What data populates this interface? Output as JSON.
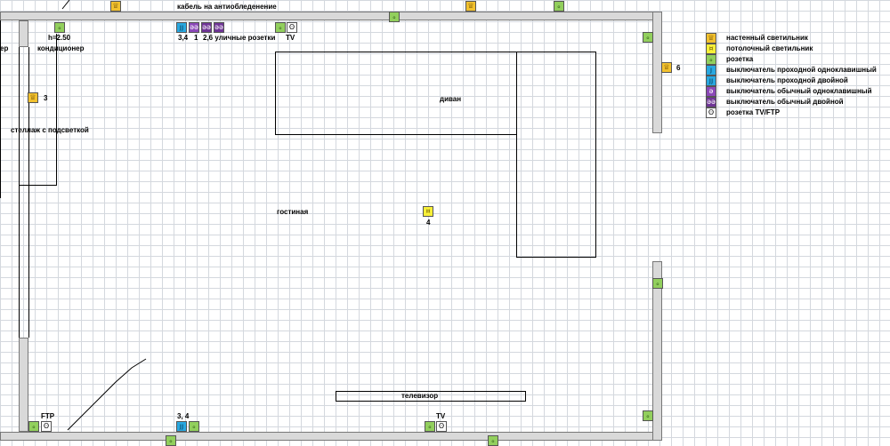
{
  "labels": {
    "cable": "кабель на антиобледенение",
    "height": "h=2.50",
    "ac": "кондиционер",
    "left_cut": "ер",
    "shelf": "стеллаж с подсветкой",
    "room": "гостиная",
    "sofa": "диван",
    "tv_stand": "телевизор",
    "switch_top_a": "3,4",
    "switch_top_b": "1",
    "switch_top_c": "2,6 уличные розетки",
    "tv_top": "TV",
    "lamp_left_num": "3",
    "ceil_num": "4",
    "lamp_right_num": "6",
    "ftp": "FTP",
    "switch_bottom": "3, 4",
    "tv_bottom": "TV"
  },
  "icons": {
    "wall_lamp": "♕",
    "ceil_lamp": "¤",
    "socket": "ₒ",
    "switch_pass_single": "ȷ",
    "switch_pass_double": "ȷȷ",
    "switch_single": "ә",
    "switch_double": "әә",
    "tv_socket": "ʘ"
  },
  "legend": [
    {
      "type": "wall-lamp",
      "icon": "♕",
      "label": "настенный светильник"
    },
    {
      "type": "ceil-lamp",
      "icon": "¤",
      "label": "потолочный светильник"
    },
    {
      "type": "socket",
      "icon": "ₒ",
      "label": "розетка"
    },
    {
      "type": "sw1pass",
      "icon": "ȷ",
      "label": "выключатель проходной одноклавишный"
    },
    {
      "type": "sw2pass",
      "icon": "ȷȷ",
      "label": "выключатель проходной двойной"
    },
    {
      "type": "sw1",
      "icon": "ә",
      "label": "выключатель обычный одноклавишный"
    },
    {
      "type": "sw2",
      "icon": "әә",
      "label": "выключатель обычный двойной"
    },
    {
      "type": "tv",
      "icon": "ʘ",
      "label": "розетка TV/FTP"
    }
  ],
  "colors": {
    "wall_lamp": "#f2c12e",
    "ceil_lamp": "#f8f038",
    "socket": "#92cf5d",
    "switch_pass": "#29a8e0",
    "switch_single": "#8b48b8",
    "switch_double": "#6f3596"
  }
}
